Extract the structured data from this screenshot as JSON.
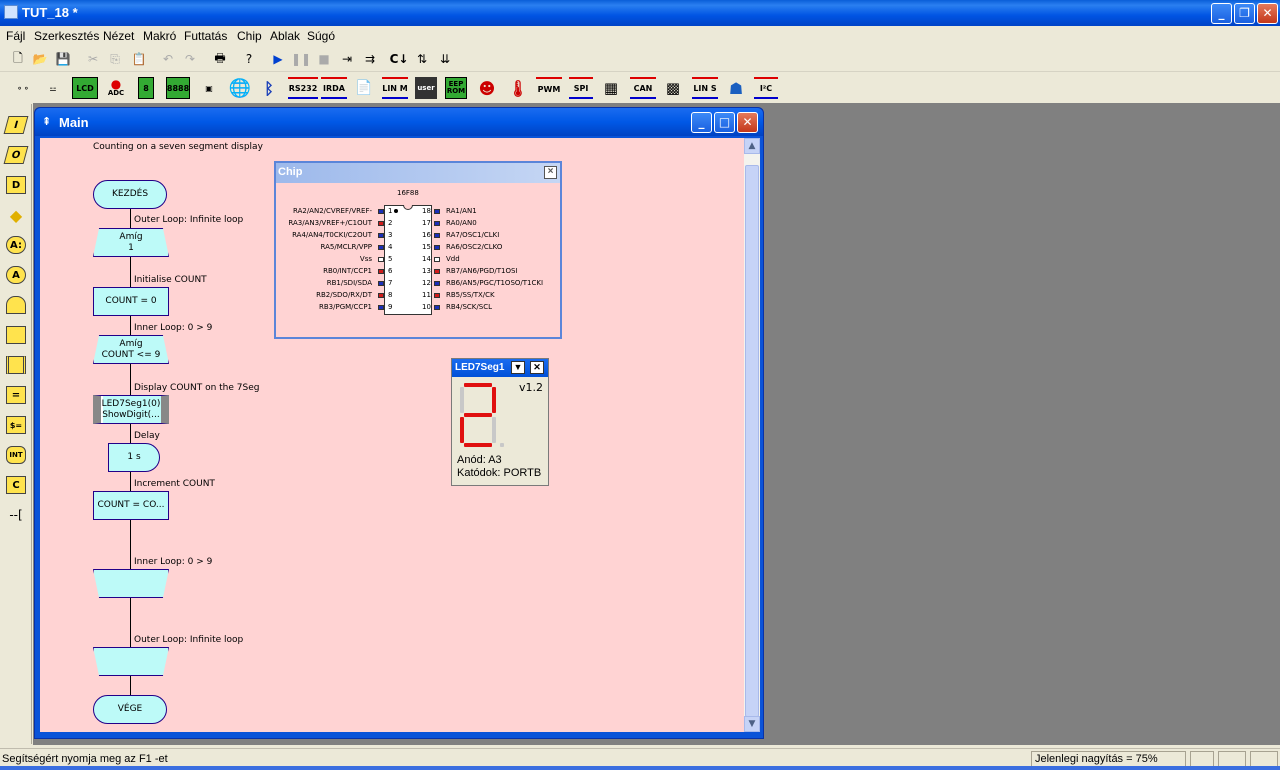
{
  "app": {
    "title": "TUT_18 *"
  },
  "menu": [
    "Fájl",
    "Szerkesztés",
    "Nézet",
    "Makró",
    "Futtatás",
    "Chip",
    "Ablak",
    "Súgó"
  ],
  "toolbar2_labels": {
    "lcd": "LCD",
    "adc": "ADC",
    "rs232": "RS232",
    "irda": "IRDA",
    "linm": "LIN M",
    "user": "user",
    "eeprom": "EEP ROM",
    "pwm": "PWM",
    "spi": "SPI",
    "can": "CAN",
    "lins": "LIN S",
    "i2c": "I²C"
  },
  "palette": [
    "I",
    "O",
    "D",
    "",
    "A:",
    "A",
    "",
    "",
    "",
    "=",
    "$=",
    "INT",
    "C",
    "--["
  ],
  "main_window": {
    "title": "Main",
    "description": "Counting on a seven segment display",
    "flow": {
      "start": "KEZDÉS",
      "outer_loop_comment": "Outer Loop: Infinite loop",
      "loop1_line1": "Amíg",
      "loop1_line2": "1",
      "init_comment": "Initialise COUNT",
      "init_box": "COUNT = 0",
      "inner_loop_comment": "Inner Loop: 0 > 9",
      "loop2_line1": "Amíg",
      "loop2_line2": "COUNT <= 9",
      "display_comment": "Display COUNT on the 7Seg",
      "macro_line1": "LED7Seg1(0)",
      "macro_line2": "ShowDigit(...",
      "delay_comment": "Delay",
      "delay_box": "1 s",
      "increment_comment": "Increment COUNT",
      "increment_box": "COUNT = CO...",
      "inner_end_comment": "Inner Loop: 0 > 9",
      "outer_end_comment": "Outer Loop: Infinite loop",
      "end": "VÉGE"
    }
  },
  "chip": {
    "title": "Chip",
    "part": "16F88",
    "left_pins": [
      {
        "name": "RA2/AN2/CVREF/VREF-",
        "num": "1",
        "color": "#1b2fb8"
      },
      {
        "name": "RA3/AN3/VREF+/C1OUT",
        "num": "2",
        "color": "#d01a1a"
      },
      {
        "name": "RA4/AN4/T0CKI/C2OUT",
        "num": "3",
        "color": "#1b2fb8"
      },
      {
        "name": "RA5/MCLR/VPP",
        "num": "4",
        "color": "#1b2fb8"
      },
      {
        "name": "Vss",
        "num": "5",
        "color": "#ffffff"
      },
      {
        "name": "RB0/INT/CCP1",
        "num": "6",
        "color": "#d01a1a"
      },
      {
        "name": "RB1/SDI/SDA",
        "num": "7",
        "color": "#1b2fb8"
      },
      {
        "name": "RB2/SDO/RX/DT",
        "num": "8",
        "color": "#d01a1a"
      },
      {
        "name": "RB3/PGM/CCP1",
        "num": "9",
        "color": "#1b2fb8"
      }
    ],
    "right_pins": [
      {
        "name": "RA1/AN1",
        "num": "18",
        "color": "#1b2fb8"
      },
      {
        "name": "RA0/AN0",
        "num": "17",
        "color": "#1b2fb8"
      },
      {
        "name": "RA7/OSC1/CLKI",
        "num": "16",
        "color": "#1b2fb8"
      },
      {
        "name": "RA6/OSC2/CLKO",
        "num": "15",
        "color": "#1b2fb8"
      },
      {
        "name": "Vdd",
        "num": "14",
        "color": "#ffffff"
      },
      {
        "name": "RB7/AN6/PGD/T1OSI",
        "num": "13",
        "color": "#d01a1a"
      },
      {
        "name": "RB6/AN5/PGC/T1OSO/T1CKI",
        "num": "12",
        "color": "#1b2fb8"
      },
      {
        "name": "RB5/SS/TX/CK",
        "num": "11",
        "color": "#d01a1a"
      },
      {
        "name": "RB4/SCK/SCL",
        "num": "10",
        "color": "#1b2fb8"
      }
    ]
  },
  "led_panel": {
    "title": "LED7Seg1",
    "version": "v1.2",
    "anode": "Anód: A3",
    "cathode": "Katódok: PORTB",
    "on_color": "#e01010",
    "off_color": "#c8c8c8"
  },
  "status": {
    "help": "Segítségért nyomja meg az F1 -et",
    "zoom": "Jelenlegi nagyítás = 75%"
  }
}
